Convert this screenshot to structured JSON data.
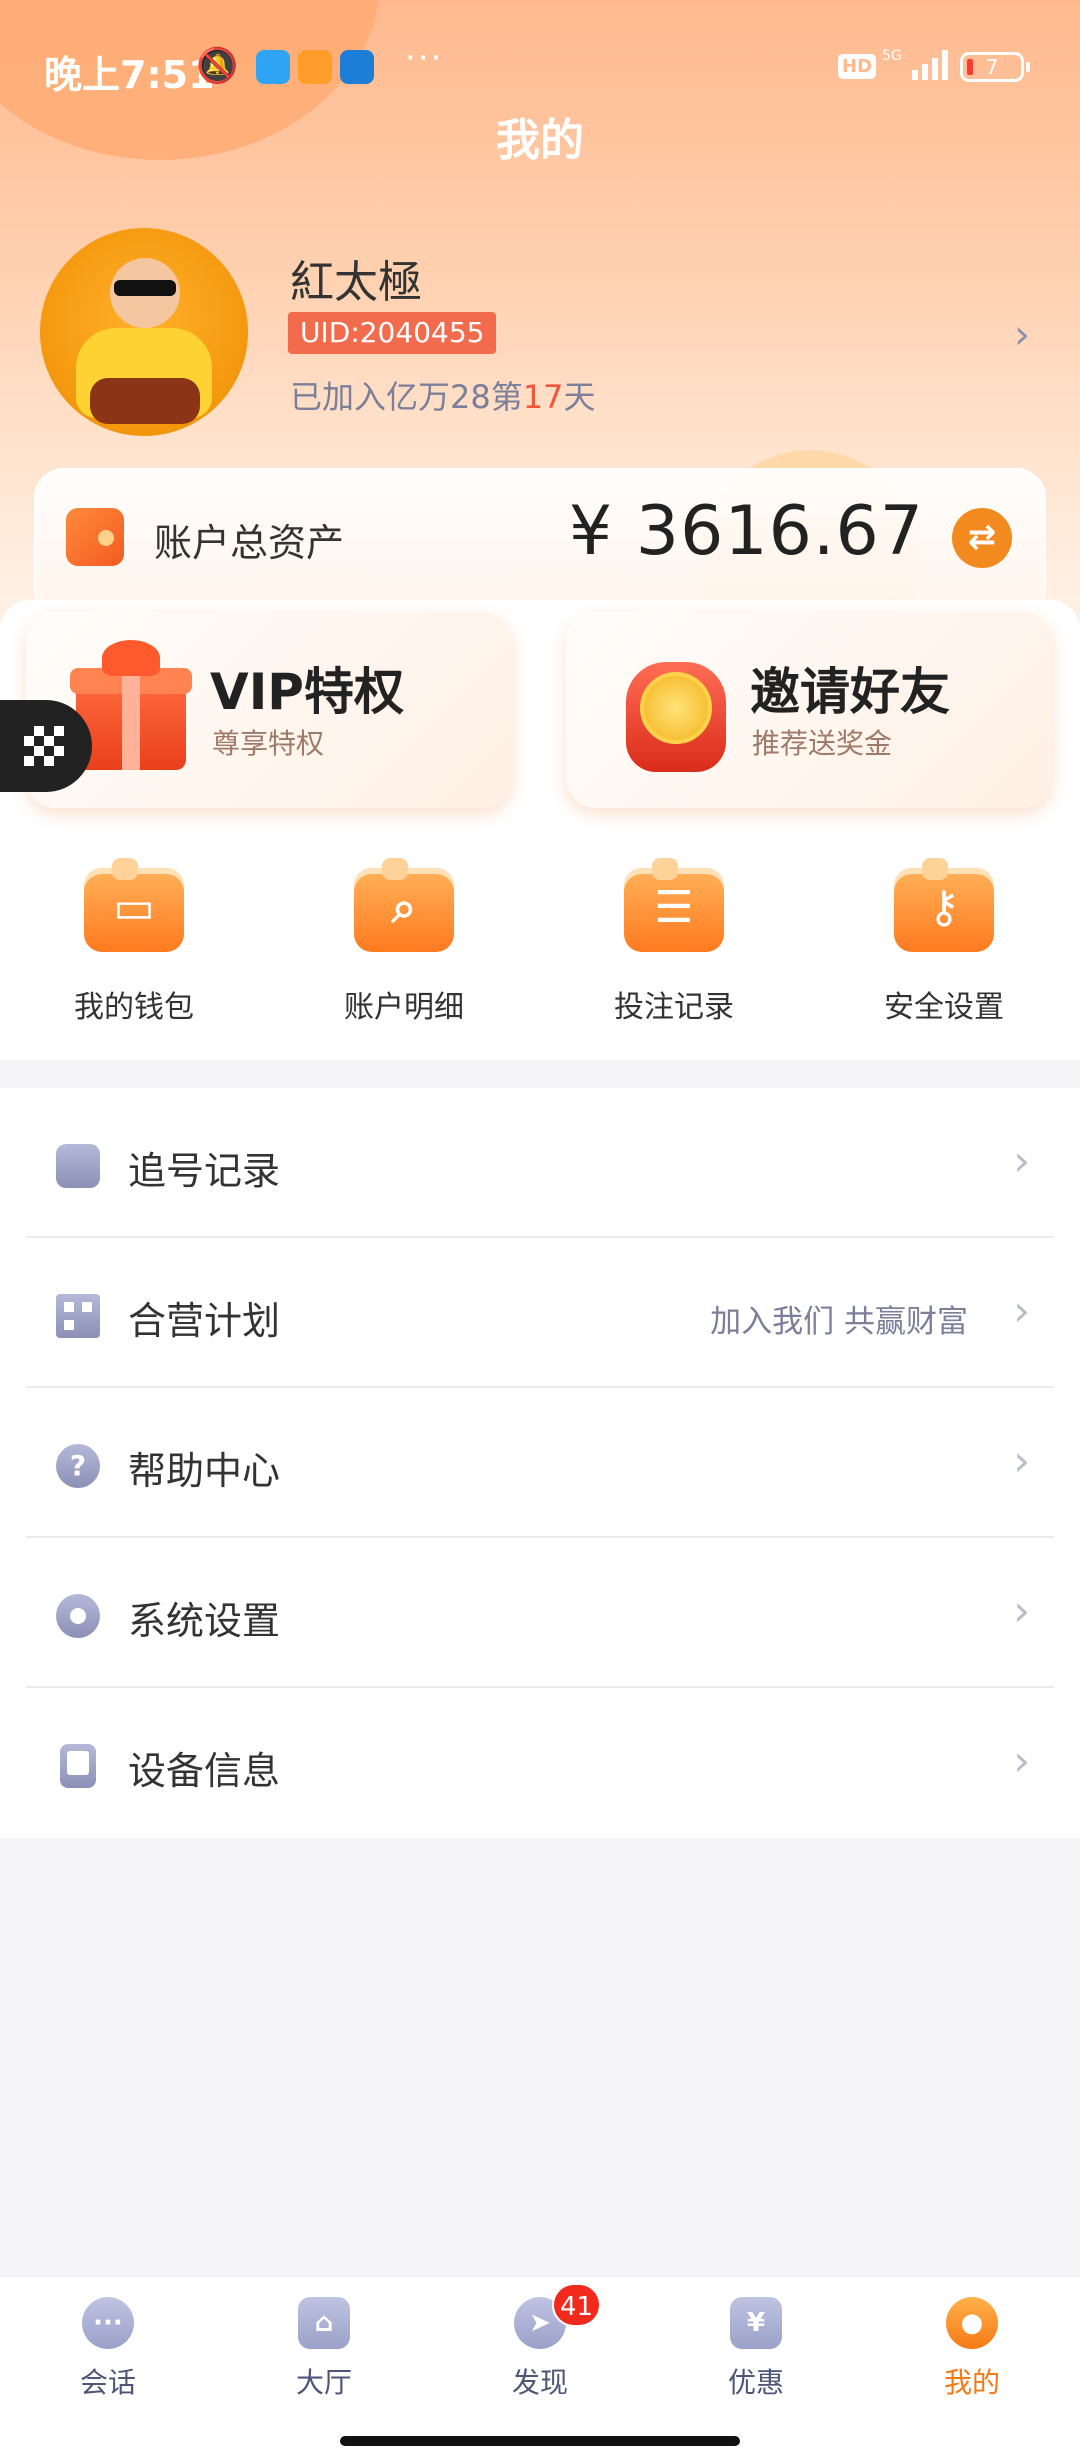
{
  "status_bar": {
    "time": "晚上7:51",
    "hd": "HD",
    "signal": "5G",
    "battery": "7"
  },
  "page_title": "我的",
  "profile": {
    "name": "紅太極",
    "uid": "UID:2040455",
    "join_prefix": "已加入亿万28第",
    "join_days": "17",
    "join_suffix": "天"
  },
  "assets": {
    "label": "账户总资产",
    "value": "¥ 3616.67"
  },
  "promos": [
    {
      "title": "VIP特权",
      "subtitle": "尊享特权"
    },
    {
      "title": "邀请好友",
      "subtitle": "推荐送奖金"
    }
  ],
  "quick_actions": [
    {
      "label": "我的钱包",
      "icon": "wallet-icon"
    },
    {
      "label": "账户明细",
      "icon": "magnifier-icon"
    },
    {
      "label": "投注记录",
      "icon": "notepad-icon"
    },
    {
      "label": "安全设置",
      "icon": "key-icon"
    }
  ],
  "menu": [
    {
      "label": "追号记录",
      "extra": "",
      "icon": "clipboard-icon"
    },
    {
      "label": "合营计划",
      "extra": "加入我们 共赢财富",
      "icon": "qr-icon"
    },
    {
      "label": "帮助中心",
      "extra": "",
      "icon": "help-icon"
    },
    {
      "label": "系统设置",
      "extra": "",
      "icon": "gear-icon"
    },
    {
      "label": "设备信息",
      "extra": "",
      "icon": "device-icon"
    }
  ],
  "bottom_nav": [
    {
      "label": "会话",
      "icon": "chat-icon"
    },
    {
      "label": "大厅",
      "icon": "hall-icon"
    },
    {
      "label": "发现",
      "icon": "compass-icon",
      "badge": "41"
    },
    {
      "label": "优惠",
      "icon": "coupon-icon"
    },
    {
      "label": "我的",
      "icon": "user-icon"
    }
  ],
  "colors": {
    "accent": "#f57a16",
    "uid_badge": "#f26b4d",
    "highlight": "#f2553a"
  }
}
